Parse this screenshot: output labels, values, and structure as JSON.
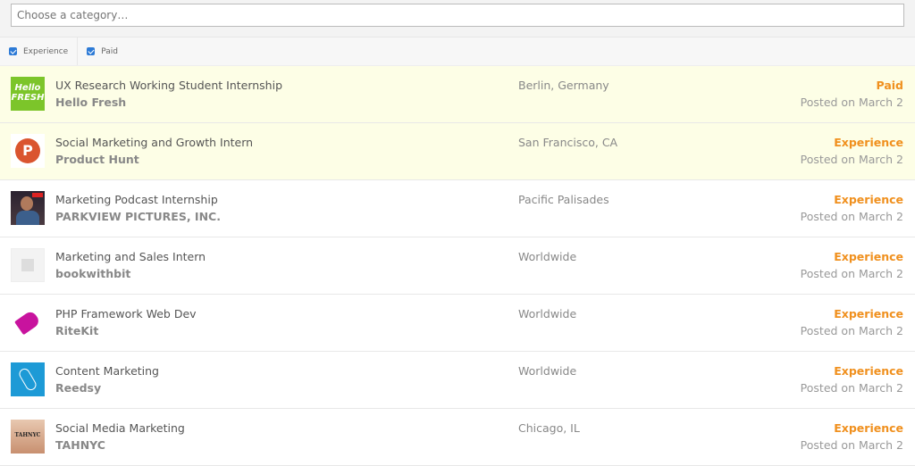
{
  "search": {
    "placeholder": "Choose a category…"
  },
  "filters": [
    {
      "label": "Experience",
      "checked": true
    },
    {
      "label": "Paid",
      "checked": true
    }
  ],
  "jobs": [
    {
      "title": "UX Research Working Student Internship",
      "company": "Hello Fresh",
      "location": "Berlin, Germany",
      "tag": "Paid",
      "date": "Posted on March 2",
      "logo": "hellofresh-logo",
      "highlight": true
    },
    {
      "title": "Social Marketing and Growth Intern",
      "company": "Product Hunt",
      "location": "San Francisco, CA",
      "tag": "Experience",
      "date": "Posted on March 2",
      "logo": "producthunt-logo",
      "highlight": true
    },
    {
      "title": "Marketing Podcast Internship",
      "company": "PARKVIEW PICTURES, INC.",
      "location": "Pacific Palisades",
      "tag": "Experience",
      "date": "Posted on March 2",
      "logo": "parkview-logo",
      "highlight": false
    },
    {
      "title": "Marketing and Sales Intern",
      "company": "bookwithbit",
      "location": "Worldwide",
      "tag": "Experience",
      "date": "Posted on March 2",
      "logo": "placeholder-building-logo",
      "highlight": false
    },
    {
      "title": "PHP Framework Web Dev",
      "company": "RiteKit",
      "location": "Worldwide",
      "tag": "Experience",
      "date": "Posted on March 2",
      "logo": "ritekit-tag-logo",
      "highlight": false
    },
    {
      "title": "Content Marketing",
      "company": "Reedsy",
      "location": "Worldwide",
      "tag": "Experience",
      "date": "Posted on March 2",
      "logo": "reedsy-bird-logo",
      "highlight": false
    },
    {
      "title": "Social Media Marketing",
      "company": "TAHNYC",
      "location": "Chicago, IL",
      "tag": "Experience",
      "date": "Posted on March 2",
      "logo": "tahnyc-logo",
      "highlight": false
    }
  ],
  "logo_text": {
    "hellofresh": "Hello FRESH",
    "producthunt": "P",
    "tahnyc": "TAHNYC"
  },
  "colors": {
    "accent": "#f0901e",
    "highlight": "#fdfee6",
    "checkbox": "#2d7ad6"
  }
}
